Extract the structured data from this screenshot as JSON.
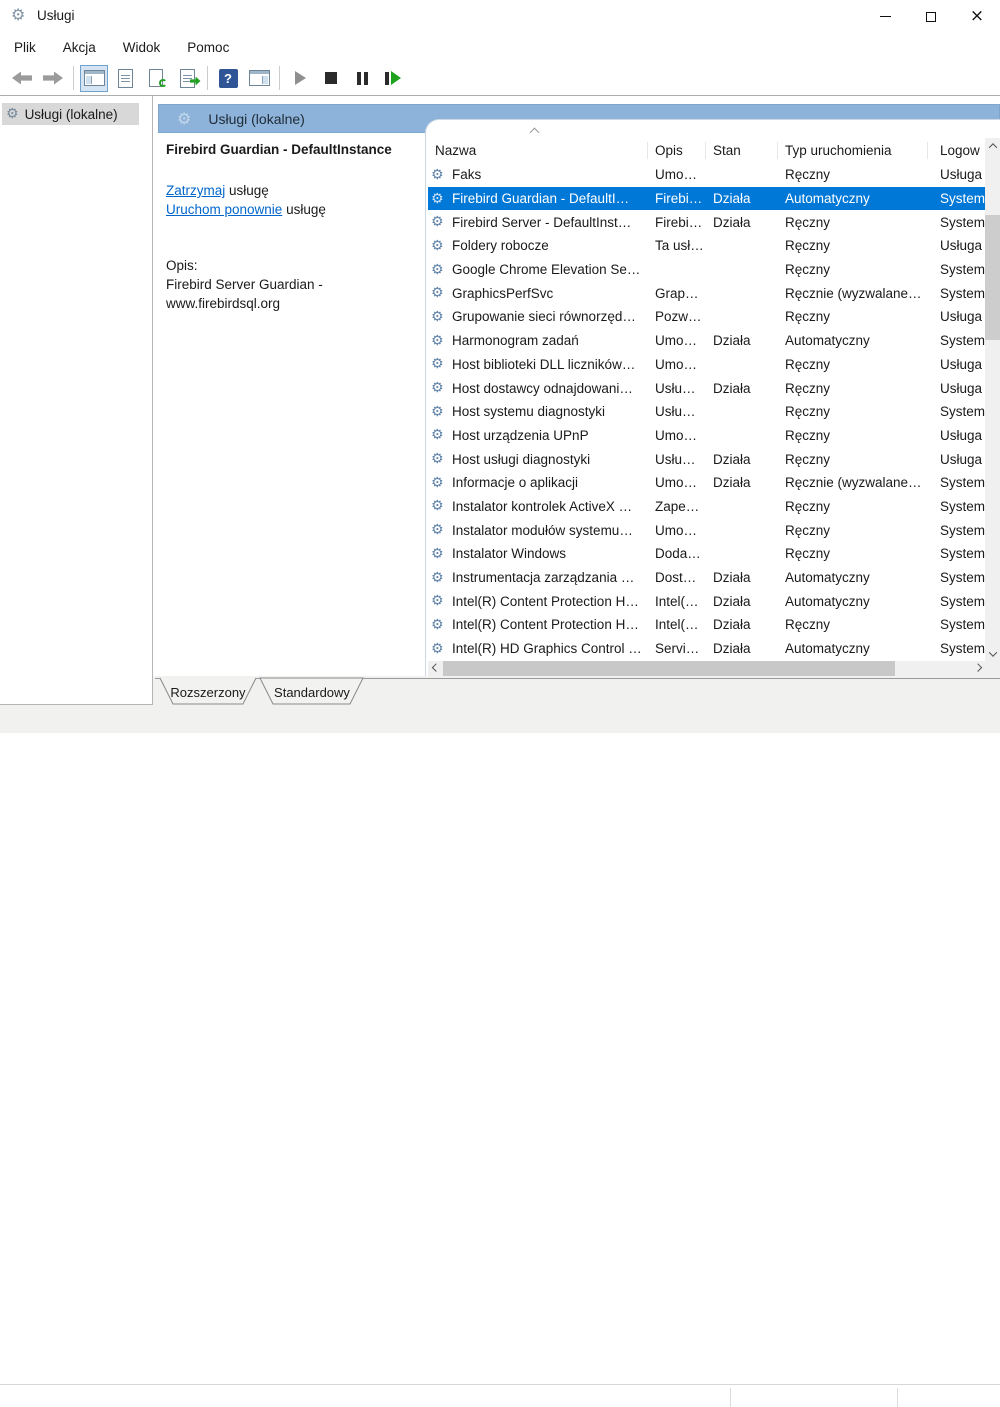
{
  "window": {
    "title": "Usługi"
  },
  "menu": [
    "Plik",
    "Akcja",
    "Widok",
    "Pomoc"
  ],
  "toolbar": {
    "icons": [
      "back",
      "forward",
      "show-console-tree",
      "properties",
      "refresh",
      "export-list",
      "help",
      "show-action-pane",
      "start-service",
      "stop-service",
      "pause-service",
      "restart-service"
    ],
    "help_glyph": "?"
  },
  "tree": {
    "item": "Usługi (lokalne)"
  },
  "band": {
    "title": "Usługi (lokalne)"
  },
  "detail": {
    "service_name": "Firebird Guardian - DefaultInstance",
    "stop": {
      "link": "Zatrzymaj",
      "rest": " usługę"
    },
    "restart": {
      "link": "Uruchom ponownie",
      "rest": " usługę"
    },
    "description_label": "Opis:",
    "description_line1": "Firebird Server Guardian -",
    "description_line2": "www.firebirdsql.org"
  },
  "table": {
    "columns": [
      "Nazwa",
      "Opis",
      "Stan",
      "Typ uruchomienia",
      "Logow"
    ],
    "sorted_column": "Nazwa",
    "rows": [
      {
        "name": "Faks",
        "opis": "Umo…",
        "stan": "",
        "typ": "Ręczny",
        "logon": "Usługa",
        "selected": false
      },
      {
        "name": "Firebird Guardian - DefaultI…",
        "opis": "Firebi…",
        "stan": "Działa",
        "typ": "Automatyczny",
        "logon": "System",
        "selected": true
      },
      {
        "name": "Firebird Server - DefaultInst…",
        "opis": "Firebi…",
        "stan": "Działa",
        "typ": "Ręczny",
        "logon": "System",
        "selected": false
      },
      {
        "name": "Foldery robocze",
        "opis": "Ta usł…",
        "stan": "",
        "typ": "Ręczny",
        "logon": "Usługa",
        "selected": false
      },
      {
        "name": "Google Chrome Elevation Se…",
        "opis": "",
        "stan": "",
        "typ": "Ręczny",
        "logon": "System",
        "selected": false
      },
      {
        "name": "GraphicsPerfSvc",
        "opis": "Grap…",
        "stan": "",
        "typ": "Ręcznie (wyzwalane…",
        "logon": "System",
        "selected": false
      },
      {
        "name": "Grupowanie sieci równorzęd…",
        "opis": "Pozw…",
        "stan": "",
        "typ": "Ręczny",
        "logon": "Usługa",
        "selected": false
      },
      {
        "name": "Harmonogram zadań",
        "opis": "Umo…",
        "stan": "Działa",
        "typ": "Automatyczny",
        "logon": "System",
        "selected": false
      },
      {
        "name": "Host biblioteki DLL liczników…",
        "opis": "Umo…",
        "stan": "",
        "typ": "Ręczny",
        "logon": "Usługa",
        "selected": false
      },
      {
        "name": "Host dostawcy odnajdowani…",
        "opis": "Usłu…",
        "stan": "Działa",
        "typ": "Ręczny",
        "logon": "Usługa",
        "selected": false
      },
      {
        "name": "Host systemu diagnostyki",
        "opis": "Usłu…",
        "stan": "",
        "typ": "Ręczny",
        "logon": "System",
        "selected": false
      },
      {
        "name": "Host urządzenia UPnP",
        "opis": "Umo…",
        "stan": "",
        "typ": "Ręczny",
        "logon": "Usługa",
        "selected": false
      },
      {
        "name": "Host usługi diagnostyki",
        "opis": "Usłu…",
        "stan": "Działa",
        "typ": "Ręczny",
        "logon": "Usługa",
        "selected": false
      },
      {
        "name": "Informacje o aplikacji",
        "opis": "Umo…",
        "stan": "Działa",
        "typ": "Ręcznie (wyzwalane…",
        "logon": "System",
        "selected": false
      },
      {
        "name": "Instalator kontrolek ActiveX …",
        "opis": "Zape…",
        "stan": "",
        "typ": "Ręczny",
        "logon": "System",
        "selected": false
      },
      {
        "name": "Instalator modułów systemu…",
        "opis": "Umo…",
        "stan": "",
        "typ": "Ręczny",
        "logon": "System",
        "selected": false
      },
      {
        "name": "Instalator Windows",
        "opis": "Doda…",
        "stan": "",
        "typ": "Ręczny",
        "logon": "System",
        "selected": false
      },
      {
        "name": "Instrumentacja zarządzania …",
        "opis": "Dost…",
        "stan": "Działa",
        "typ": "Automatyczny",
        "logon": "System",
        "selected": false
      },
      {
        "name": "Intel(R) Content Protection H…",
        "opis": "Intel(…",
        "stan": "Działa",
        "typ": "Automatyczny",
        "logon": "System",
        "selected": false
      },
      {
        "name": "Intel(R) Content Protection H…",
        "opis": "Intel(…",
        "stan": "Działa",
        "typ": "Ręczny",
        "logon": "System",
        "selected": false
      },
      {
        "name": "Intel(R) HD Graphics Control …",
        "opis": "Servi…",
        "stan": "Działa",
        "typ": "Automatyczny",
        "logon": "System",
        "selected": false
      }
    ]
  },
  "tabs": {
    "items": [
      "Rozszerzony",
      "Standardowy"
    ],
    "active": "Rozszerzony"
  }
}
